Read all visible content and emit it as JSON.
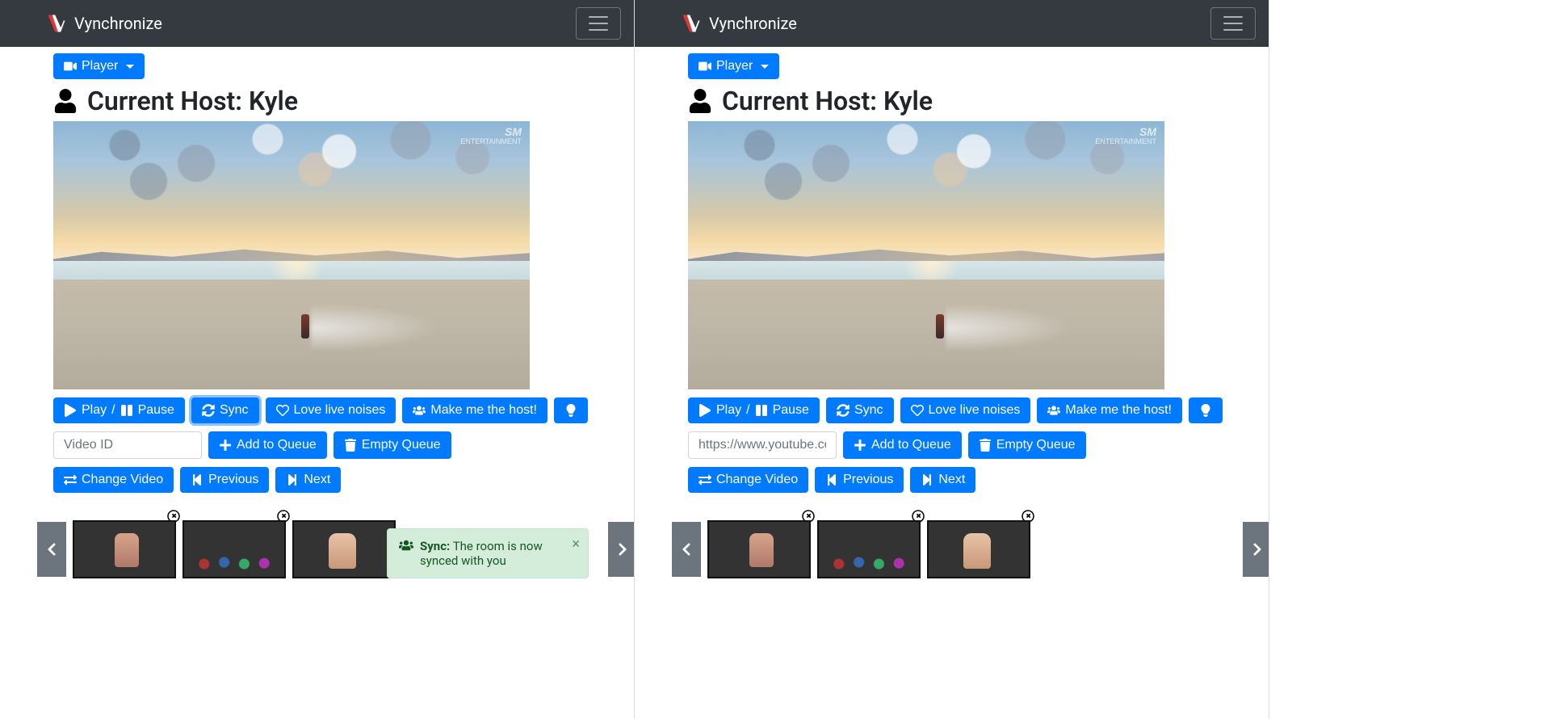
{
  "brand": "Vynchronize",
  "player_dropdown_label": "Player",
  "host": {
    "prefix": "Current Host: ",
    "name": "Kyle"
  },
  "watermark": {
    "top": "SM",
    "bottom": "ENTERTAINMENT"
  },
  "controls": {
    "play_pause_play": "Play",
    "play_pause_sep": " / ",
    "play_pause_pause": "Pause",
    "sync": "Sync",
    "love": "Love live noises",
    "make_host": "Make me the host!",
    "add_queue": "Add to Queue",
    "empty_queue": "Empty Queue",
    "change_video": "Change Video",
    "previous": "Previous",
    "next": "Next"
  },
  "left": {
    "video_input_placeholder": "Video ID"
  },
  "right": {
    "video_input_placeholder": "https://www.youtube.com"
  },
  "toast": {
    "title": "Sync:",
    "message": "The room is now synced with you"
  }
}
